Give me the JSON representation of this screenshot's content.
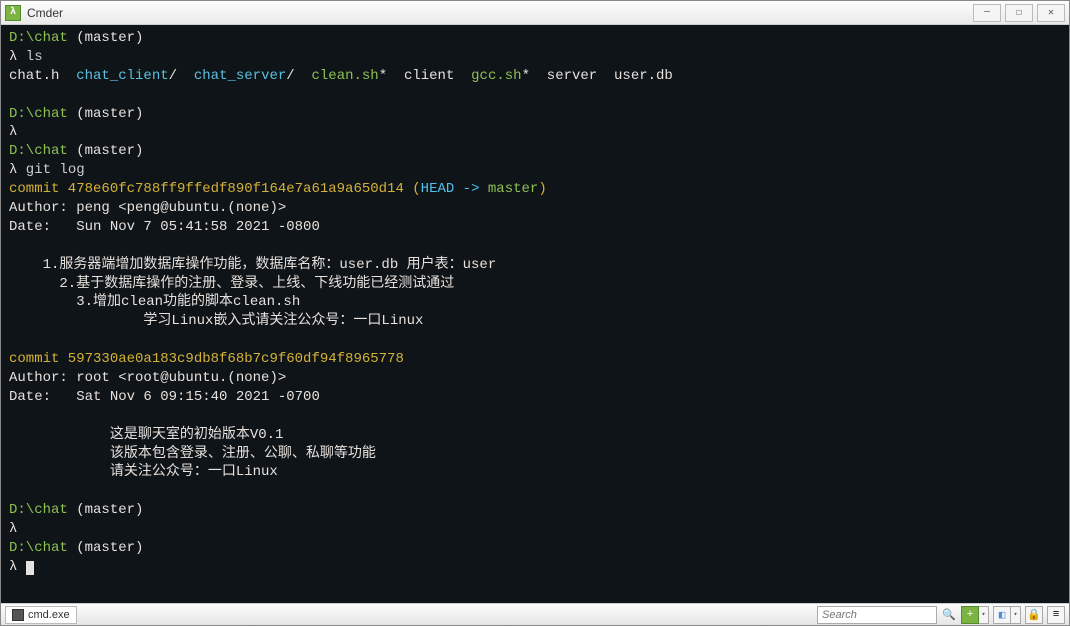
{
  "window": {
    "title": "Cmder"
  },
  "terminal": {
    "prompt1_path": "D:\\chat",
    "prompt1_branch": " (master)",
    "lambda": "λ",
    "cmd_ls": " ls",
    "ls_out": {
      "f1": "chat.h  ",
      "f2": "chat_client",
      "f2s": "/  ",
      "f3": "chat_server",
      "f3s": "/  ",
      "f4": "clean.sh",
      "f4s": "*  ",
      "f5": "client  ",
      "f6": "gcc.sh",
      "f6s": "*  ",
      "f7": "server  ",
      "f8": "user.db"
    },
    "cmd_gitlog": " git log",
    "commit1": "commit 478e60fc788ff9ffedf890f164e7a61a9a650d14 ",
    "commit1_paren_open": "(",
    "commit1_head": "HEAD -> ",
    "commit1_master": "master",
    "commit1_paren_close": ")",
    "author1": "Author: peng <peng@ubuntu.(none)>",
    "date1": "Date:   Sun Nov 7 05:41:58 2021 -0800",
    "msg1_1": "    1.服务器端增加数据库操作功能，数据库名称：user.db 用户表：user",
    "msg1_2": "      2.基于数据库操作的注册、登录、上线、下线功能已经测试通过",
    "msg1_3": "        3.增加clean功能的脚本clean.sh",
    "msg1_4": "                学习Linux嵌入式请关注公众号：一口Linux",
    "commit2": "commit 597330ae0a183c9db8f68b7c9f60df94f8965778",
    "author2": "Author: root <root@ubuntu.(none)>",
    "date2": "Date:   Sat Nov 6 09:15:40 2021 -0700",
    "msg2_1": "            这是聊天室的初始版本V0.1",
    "msg2_2": "            该版本包含登录、注册、公聊、私聊等功能",
    "msg2_3": "            请关注公众号：一口Linux"
  },
  "statusbar": {
    "tab_label": "cmd.exe",
    "search_placeholder": "Search"
  }
}
